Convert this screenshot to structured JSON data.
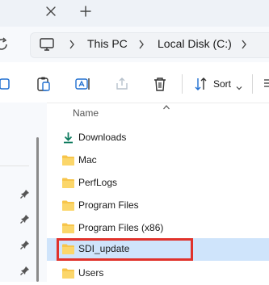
{
  "address": {
    "segments": [
      "This PC",
      "Local Disk (C:)"
    ]
  },
  "toolbar": {
    "sort_label": "Sort"
  },
  "list": {
    "column_name": "Name",
    "items": [
      {
        "label": "Downloads",
        "icon": "download-arrow-icon"
      },
      {
        "label": "Mac",
        "icon": "folder-icon"
      },
      {
        "label": "PerfLogs",
        "icon": "folder-icon"
      },
      {
        "label": "Program Files",
        "icon": "folder-icon"
      },
      {
        "label": "Program Files (x86)",
        "icon": "folder-icon"
      },
      {
        "label": "SDI_update",
        "icon": "folder-icon",
        "selected": true
      },
      {
        "label": "Users",
        "icon": "folder-icon"
      }
    ]
  },
  "colors": {
    "accent": "#0f7b5f",
    "folder": "#f7c54b",
    "selection": "#cfe4fb",
    "highlight_border": "#e0322b"
  }
}
